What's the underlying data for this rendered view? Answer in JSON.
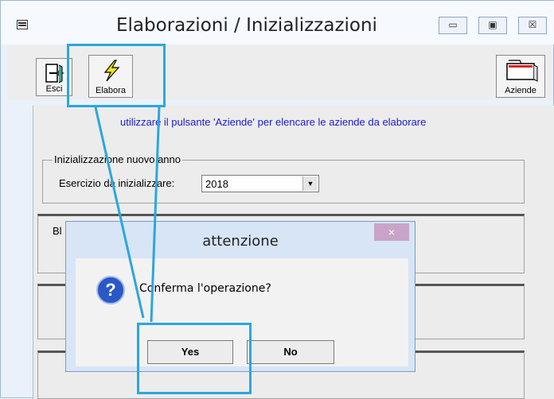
{
  "window": {
    "title": "Elaborazioni / Inizializzazioni",
    "minimize_glyph": "▭",
    "maximize_glyph": "▣",
    "close_glyph": "☒"
  },
  "toolbar": {
    "esci_label": "Esci",
    "elabora_label": "Elabora",
    "aziende_label": "Aziende"
  },
  "main": {
    "hint": "utilizzare il pulsante 'Aziende' per elencare le aziende da elaborare",
    "group_title": "Inizializzazione nuovo anno",
    "field_label": "Esercizio da inizializzare:",
    "field_value": "2018",
    "next_group_partial": "Bl"
  },
  "dialog": {
    "title": "attenzione",
    "close_glyph": "×",
    "icon": "question-icon",
    "icon_glyph": "?",
    "message": "Conferma l'operazione?",
    "yes_label": "Yes",
    "no_label": "No"
  },
  "colors": {
    "highlight": "#2aa7df",
    "hint_text": "#1a1ad0"
  }
}
